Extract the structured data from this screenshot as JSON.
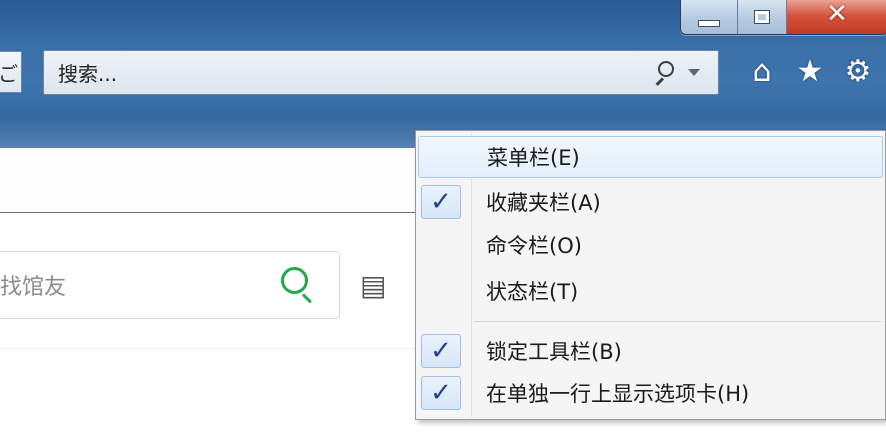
{
  "window": {
    "controls": {
      "minimize": "minimize",
      "maximize": "maximize",
      "close": "✕"
    }
  },
  "address": {
    "left_fragment": "ご"
  },
  "search": {
    "placeholder": "搜索..."
  },
  "toolbar": {
    "icons": [
      "home-icon",
      "star-icon",
      "gear-icon"
    ]
  },
  "page": {
    "site_search_placeholder": "找馆友"
  },
  "context_menu": {
    "items": [
      {
        "label": "菜单栏(E)",
        "checked": false,
        "highlighted": true
      },
      {
        "label": "收藏夹栏(A)",
        "checked": true,
        "highlighted": false
      },
      {
        "label": "命令栏(O)",
        "checked": false,
        "highlighted": false
      },
      {
        "label": "状态栏(T)",
        "checked": false,
        "highlighted": false
      },
      {
        "label": "锁定工具栏(B)",
        "checked": true,
        "highlighted": false
      },
      {
        "label": "在单独一行上显示选项卡(H)",
        "checked": true,
        "highlighted": false
      }
    ]
  },
  "colors": {
    "chrome_blue": "#3a6ea8",
    "close_red": "#c23a22",
    "check_blue": "#1f3f8a",
    "search_green": "#25a84a"
  }
}
